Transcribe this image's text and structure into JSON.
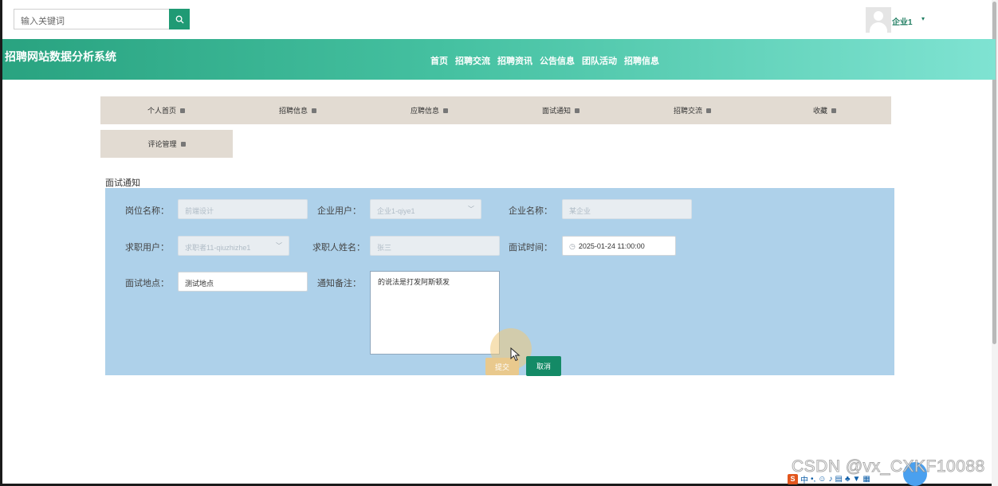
{
  "search": {
    "placeholder": "输入关键词"
  },
  "user": {
    "name": "企业1",
    "caret": "▾"
  },
  "site_title": "招聘网站数据分析系统",
  "nav": [
    "首页",
    "招聘交流",
    "招聘资讯",
    "公告信息",
    "团队活动",
    "招聘信息"
  ],
  "tabs": [
    "个人首页",
    "招聘信息",
    "应聘信息",
    "面试通知",
    "招聘交流",
    "收藏",
    "评论管理"
  ],
  "section_title": "面试通知",
  "form": {
    "post_name": {
      "label": "岗位名称：",
      "value": "前端设计"
    },
    "company_user": {
      "label": "企业用户：",
      "value": "企业1-qiye1"
    },
    "company_name": {
      "label": "企业名称：",
      "value": "某企业"
    },
    "job_seeker": {
      "label": "求职用户：",
      "value": "求职者11-qiuzhizhe1"
    },
    "seeker_name": {
      "label": "求职人姓名：",
      "value": "张三"
    },
    "interview_time": {
      "label": "面试时间：",
      "value": "2025-01-24 11:00:00"
    },
    "interview_place": {
      "label": "面试地点：",
      "value": "测试地点"
    },
    "notice_note": {
      "label": "通知备注：",
      "value": "的说法是打发阿斯顿发"
    }
  },
  "buttons": {
    "submit": "提交",
    "cancel": "取消"
  },
  "watermark": "CSDN @vx_CXKF10088",
  "colors": {
    "brand": "#1f9a74",
    "header_end": "#7fe3d2",
    "panel": "#aed1ea",
    "tab_bg": "#e2dbd2"
  }
}
